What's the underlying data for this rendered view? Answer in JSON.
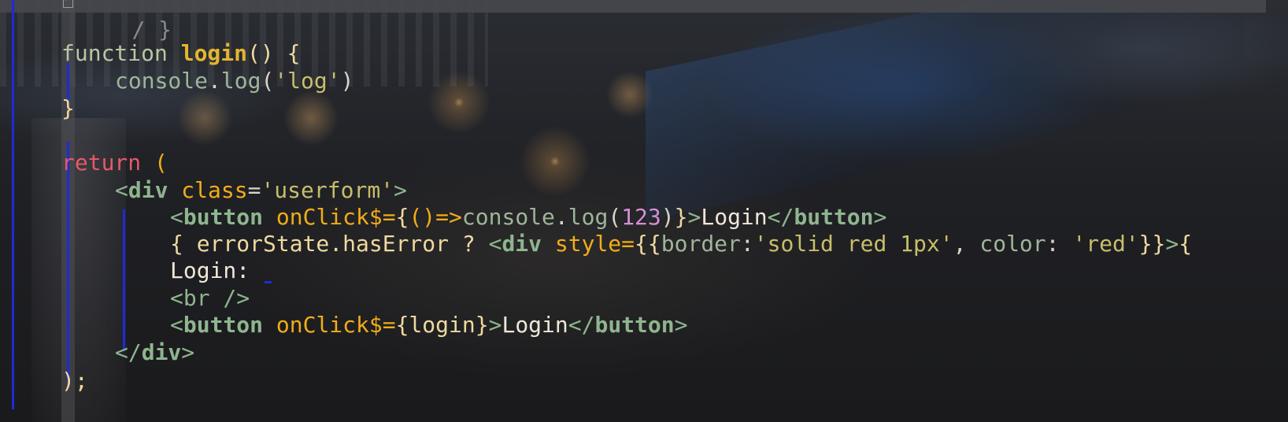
{
  "editor": {
    "lines": {
      "l0": {
        "text": "/ }"
      },
      "l1": {
        "kw": "function",
        "name": "login",
        "rest": "() {"
      },
      "l2": {
        "obj": "console",
        "dot": ".",
        "method": "log",
        "open": "(",
        "str": "'log'",
        "close": ")"
      },
      "l3": {
        "text": "}"
      },
      "l4": {
        "kw": "return",
        "rest": " ("
      },
      "l5": {
        "open": "<",
        "tag": "div",
        "attr": "class",
        "eq": "=",
        "str": "'userform'",
        "close": ">"
      },
      "l6": {
        "open": "<",
        "tag": "button",
        "attr": "onClick$",
        "eq": "=",
        "lbrace": "{",
        "paren": "()",
        "arrow": "=>",
        "obj": "console",
        "dot": ".",
        "method": "log",
        "popen": "(",
        "num": "123",
        "pclose": ")",
        "rbrace": "}",
        "gt": ">",
        "text": "Login",
        "closeopen": "</",
        "closetag": "button",
        "closegt": ">"
      },
      "l7": {
        "lead": "{ errorState.hasError ? ",
        "open": "<",
        "tag": "div",
        "attr": "style",
        "eq": "=",
        "braces": "{{",
        "prop1": "border",
        "colon1": ":",
        "str1": "'solid red 1px'",
        "comma": ", ",
        "prop2": "color",
        "colon2": ": ",
        "str2": "'red'",
        "endbraces": "}}",
        "gt": ">",
        "tail": "{"
      },
      "l8": {
        "text": "Login:"
      },
      "l9": {
        "text": "<br />"
      },
      "l10": {
        "open": "<",
        "tag": "button",
        "attr": "onClick$",
        "eq": "=",
        "expr": "{login}",
        "gt": ">",
        "text": "Login",
        "closeopen": "</",
        "closetag": "button",
        "closegt": ">"
      },
      "l11": {
        "open": "</",
        "tag": "div",
        "close": ">"
      },
      "l12": {
        "text": ");"
      }
    }
  }
}
